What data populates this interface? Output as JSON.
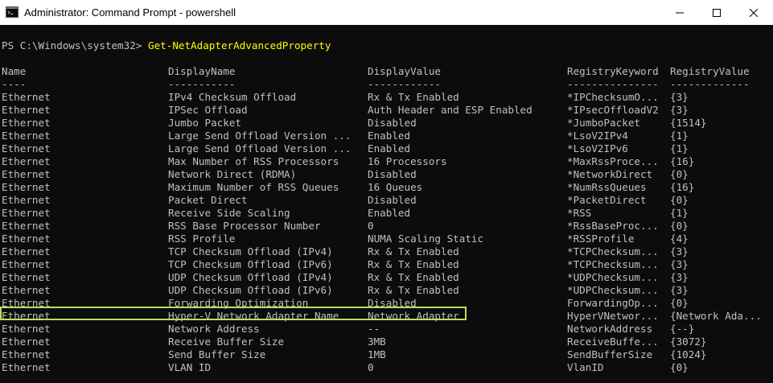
{
  "window": {
    "title": "Administrator: Command Prompt - powershell",
    "app_icon": "cmd-icon",
    "controls": [
      "minimize-icon",
      "maximize-icon",
      "close-icon"
    ]
  },
  "console": {
    "prompt": "PS C:\\Windows\\system32> ",
    "command": "Get-NetAdapterAdvancedProperty",
    "headers": [
      "Name",
      "DisplayName",
      "DisplayValue",
      "RegistryKeyword",
      "RegistryValue"
    ],
    "separators": [
      "----",
      "-----------",
      "------------",
      "---------------",
      "-------------"
    ],
    "rows": [
      [
        "Ethernet",
        "IPv4 Checksum Offload",
        "Rx & Tx Enabled",
        "*IPChecksumO...",
        "{3}"
      ],
      [
        "Ethernet",
        "IPSec Offload",
        "Auth Header and ESP Enabled",
        "*IPsecOffloadV2",
        "{3}"
      ],
      [
        "Ethernet",
        "Jumbo Packet",
        "Disabled",
        "*JumboPacket",
        "{1514}"
      ],
      [
        "Ethernet",
        "Large Send Offload Version ...",
        "Enabled",
        "*LsoV2IPv4",
        "{1}"
      ],
      [
        "Ethernet",
        "Large Send Offload Version ...",
        "Enabled",
        "*LsoV2IPv6",
        "{1}"
      ],
      [
        "Ethernet",
        "Max Number of RSS Processors",
        "16 Processors",
        "*MaxRssProce...",
        "{16}"
      ],
      [
        "Ethernet",
        "Network Direct (RDMA)",
        "Disabled",
        "*NetworkDirect",
        "{0}"
      ],
      [
        "Ethernet",
        "Maximum Number of RSS Queues",
        "16 Queues",
        "*NumRssQueues",
        "{16}"
      ],
      [
        "Ethernet",
        "Packet Direct",
        "Disabled",
        "*PacketDirect",
        "{0}"
      ],
      [
        "Ethernet",
        "Receive Side Scaling",
        "Enabled",
        "*RSS",
        "{1}"
      ],
      [
        "Ethernet",
        "RSS Base Processor Number",
        "0",
        "*RssBaseProc...",
        "{0}"
      ],
      [
        "Ethernet",
        "RSS Profile",
        "NUMA Scaling Static",
        "*RSSProfile",
        "{4}"
      ],
      [
        "Ethernet",
        "TCP Checksum Offload (IPv4)",
        "Rx & Tx Enabled",
        "*TCPChecksum...",
        "{3}"
      ],
      [
        "Ethernet",
        "TCP Checksum Offload (IPv6)",
        "Rx & Tx Enabled",
        "*TCPChecksum...",
        "{3}"
      ],
      [
        "Ethernet",
        "UDP Checksum Offload (IPv4)",
        "Rx & Tx Enabled",
        "*UDPChecksum...",
        "{3}"
      ],
      [
        "Ethernet",
        "UDP Checksum Offload (IPv6)",
        "Rx & Tx Enabled",
        "*UDPChecksum...",
        "{3}"
      ],
      [
        "Ethernet",
        "Forwarding Optimization",
        "Disabled",
        "ForwardingOp...",
        "{0}"
      ],
      [
        "Ethernet",
        "Hyper-V Network Adapter Name",
        "Network Adapter",
        "HyperVNetwor...",
        "{Network Ada..."
      ],
      [
        "Ethernet",
        "Network Address",
        "--",
        "NetworkAddress",
        "{--}"
      ],
      [
        "Ethernet",
        "Receive Buffer Size",
        "3MB",
        "ReceiveBuffe...",
        "{3072}"
      ],
      [
        "Ethernet",
        "Send Buffer Size",
        "1MB",
        "SendBufferSize",
        "{1024}"
      ],
      [
        "Ethernet",
        "VLAN ID",
        "0",
        "VlanID",
        "{0}"
      ]
    ],
    "highlight_color": "#b6e05f"
  }
}
